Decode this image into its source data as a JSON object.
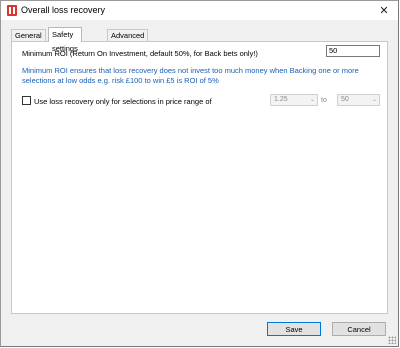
{
  "window": {
    "title": "Overall loss recovery",
    "icon": "app-icon"
  },
  "tabs": [
    {
      "label": "General",
      "active": false
    },
    {
      "label": "Safety settings",
      "active": true
    },
    {
      "label": "Advanced",
      "active": false
    }
  ],
  "safety": {
    "roi_label": "Minimum ROI (Return On Investment, default 50%, for Back bets only!)",
    "roi_value": "50",
    "help_text": "Minimum ROI ensures that loss recovery does not invest too much money when Backing one or more selections at low odds e.g. risk £100 to win £5 is ROI of 5%",
    "checkbox_label": "Use loss recovery only for selections in price range of",
    "checkbox_checked": false,
    "price_from": "1.25",
    "to_label": "to",
    "price_to": "50"
  },
  "buttons": {
    "save_label": "Save",
    "cancel_label": "Cancel"
  },
  "colors": {
    "help_text": "#1a5fb4",
    "app_icon": "#d9352a",
    "default_button_border": "#0078d7"
  }
}
